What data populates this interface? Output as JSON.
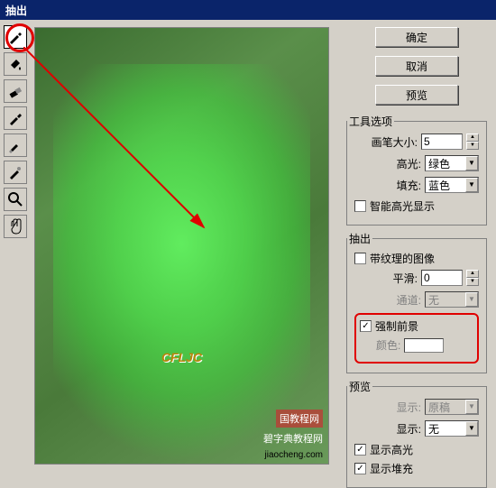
{
  "title": "抽出",
  "buttons": {
    "ok": "确定",
    "cancel": "取消",
    "preview": "预览"
  },
  "tool_options": {
    "label": "工具选项",
    "brush_size_label": "画笔大小:",
    "brush_size_value": "5",
    "highlight_label": "高光:",
    "highlight_value": "绿色",
    "fill_label": "填充:",
    "fill_value": "蓝色",
    "smart_highlight": "智能高光显示"
  },
  "extract": {
    "label": "抽出",
    "textured_image": "带纹理的图像",
    "smooth_label": "平滑:",
    "smooth_value": "0",
    "channel_label": "通道:",
    "channel_value": "无",
    "force_foreground": "强制前景",
    "color_label": "颜色:"
  },
  "preview_group": {
    "label": "预览",
    "display_label": "显示:",
    "display_value": "原稿",
    "show_label": "显示:",
    "show_value": "无",
    "show_highlight": "显示高光",
    "show_fill": "显示堆充"
  },
  "watermarks": {
    "w1": "CFLJC",
    "w2": "国教程网",
    "w3": "碧字典教程网",
    "w4": "jiaocheng.com"
  },
  "tools": [
    "edge-highlighter",
    "fill",
    "eraser",
    "eyedropper",
    "cleanup",
    "edge-touchup",
    "zoom",
    "hand"
  ]
}
